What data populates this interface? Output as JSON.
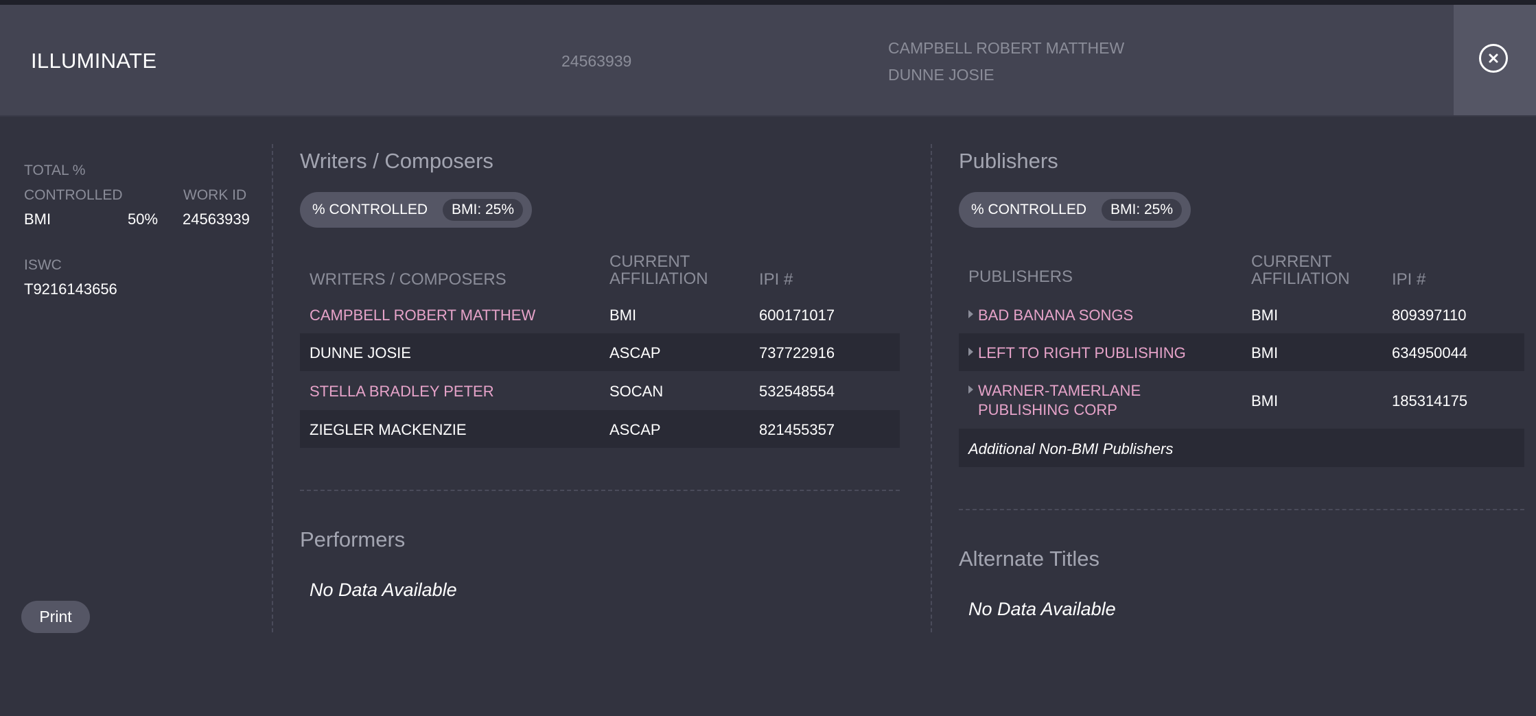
{
  "header": {
    "title": "ILLUMINATE",
    "work_id": "24563939",
    "writers": [
      "CAMPBELL ROBERT MATTHEW",
      "DUNNE JOSIE"
    ]
  },
  "summary": {
    "total_label_line1": "TOTAL %",
    "total_label_line2": "CONTROLLED",
    "work_id_label": "WORK ID",
    "org": "BMI",
    "percent": "50%",
    "work_id": "24563939",
    "iswc_label": "ISWC",
    "iswc": "T9216143656",
    "print_label": "Print"
  },
  "writers_section": {
    "title": "Writers / Composers",
    "pill_label": "% CONTROLLED",
    "pill_chip": "BMI: 25%",
    "columns": [
      "WRITERS / COMPOSERS",
      "CURRENT AFFILIATION",
      "IPI #"
    ],
    "rows": [
      {
        "name": "CAMPBELL ROBERT MATTHEW",
        "affiliation": "BMI",
        "ipi": "600171017"
      },
      {
        "name": "DUNNE JOSIE",
        "affiliation": "ASCAP",
        "ipi": "737722916"
      },
      {
        "name": "STELLA BRADLEY PETER",
        "affiliation": "SOCAN",
        "ipi": "532548554"
      },
      {
        "name": "ZIEGLER MACKENZIE",
        "affiliation": "ASCAP",
        "ipi": "821455357"
      }
    ]
  },
  "publishers_section": {
    "title": "Publishers",
    "pill_label": "% CONTROLLED",
    "pill_chip": "BMI: 25%",
    "columns": [
      "PUBLISHERS",
      "CURRENT AFFILIATION",
      "IPI #"
    ],
    "rows": [
      {
        "name": "BAD BANANA SONGS",
        "affiliation": "BMI",
        "ipi": "809397110"
      },
      {
        "name": "LEFT TO RIGHT PUBLISHING",
        "affiliation": "BMI",
        "ipi": "634950044"
      },
      {
        "name_line1": "WARNER-TAMERLANE",
        "name_line2": "PUBLISHING CORP",
        "affiliation": "BMI",
        "ipi": "185314175"
      }
    ],
    "additional": "Additional Non-BMI Publishers"
  },
  "performers_section": {
    "title": "Performers",
    "empty": "No Data Available"
  },
  "alternate_titles_section": {
    "title": "Alternate Titles",
    "empty": "No Data Available"
  },
  "colors": {
    "background": "#32333f",
    "header": "#434452",
    "link_pink": "#e6a3c9",
    "muted_text": "#8b8d99"
  },
  "icons": {
    "close": "close-icon",
    "expand": "caret-right-icon"
  }
}
